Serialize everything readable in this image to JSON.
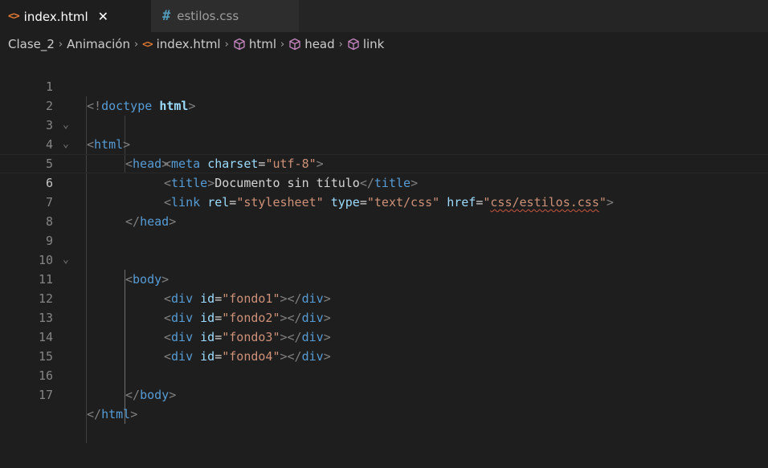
{
  "tabs": [
    {
      "icon": "html-file-icon",
      "label": "index.html",
      "close": "✕",
      "active": true
    },
    {
      "icon": "css-file-icon",
      "label": "estilos.css",
      "active": false
    }
  ],
  "breadcrumb": {
    "items": [
      "Clase_2",
      "Animación",
      "index.html",
      "html",
      "head",
      "link"
    ],
    "separator": "›"
  },
  "editor": {
    "current_line": 6,
    "lines": [
      {
        "n": "1",
        "doctype_open": "<!",
        "doctype_kw": "doctype",
        "doctype_tag": "html",
        "close": ">"
      },
      {
        "n": "2",
        "open": "<",
        "tag": "html",
        "close": ">"
      },
      {
        "n": "3",
        "open": "<",
        "tag": "head",
        "close": ">"
      },
      {
        "n": "4",
        "open": "<",
        "tag": "meta",
        "attr": "charset",
        "eq": "=",
        "val": "\"utf-8\"",
        "close": ">"
      },
      {
        "n": "5",
        "open": "<",
        "tag": "title",
        "close": ">",
        "text": "Documento sin título",
        "end_open": "</",
        "end_tag": "title",
        "end_close": ">"
      },
      {
        "n": "6",
        "open": "<",
        "tag": "link",
        "attr1": "rel",
        "val1": "\"stylesheet\"",
        "attr2": "type",
        "val2": "\"text/css\"",
        "attr3": "href",
        "val3_q1": "\"",
        "val3": "css/estilos.css",
        "val3_q2": "\"",
        "close": ">"
      },
      {
        "n": "7",
        "open": "</",
        "tag": "head",
        "close": ">"
      },
      {
        "n": "8"
      },
      {
        "n": "9",
        "open": "<",
        "tag": "body",
        "close": ">"
      },
      {
        "n": "10"
      },
      {
        "n": "11",
        "open": "<",
        "tag": "div",
        "attr": "id",
        "eq": "=",
        "val": "\"fondo1\"",
        "close": ">",
        "end_open": "</",
        "end_tag": "div",
        "end_close": ">"
      },
      {
        "n": "12",
        "open": "<",
        "tag": "div",
        "attr": "id",
        "eq": "=",
        "val": "\"fondo2\"",
        "close": ">",
        "end_open": "</",
        "end_tag": "div",
        "end_close": ">"
      },
      {
        "n": "13",
        "open": "<",
        "tag": "div",
        "attr": "id",
        "eq": "=",
        "val": "\"fondo3\"",
        "close": ">",
        "end_open": "</",
        "end_tag": "div",
        "end_close": ">"
      },
      {
        "n": "14",
        "open": "<",
        "tag": "div",
        "attr": "id",
        "eq": "=",
        "val": "\"fondo4\"",
        "close": ">",
        "end_open": "</",
        "end_tag": "div",
        "end_close": ">"
      },
      {
        "n": "15"
      },
      {
        "n": "16",
        "open": "</",
        "tag": "body",
        "close": ">"
      },
      {
        "n": "17",
        "open": "</",
        "tag": "html",
        "close": ">"
      }
    ],
    "eq": "=",
    "space": " "
  },
  "colors": {
    "background": "#1e1e1e",
    "tag": "#569cd6",
    "attribute": "#9cdcfe",
    "string": "#ce9178",
    "punctuation": "#808080",
    "html_icon": "#e37933",
    "css_icon": "#519aba"
  }
}
